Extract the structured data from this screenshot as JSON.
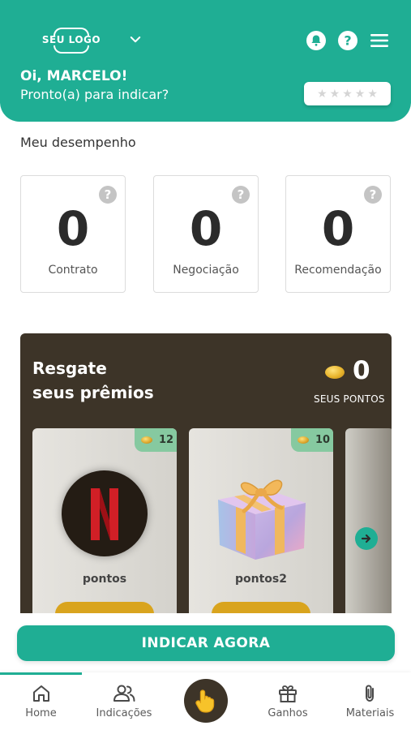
{
  "header": {
    "logo_text": "SEU LOGO",
    "greeting": "Oi, MARCELO!",
    "subtitle": "Pronto(a) para indicar?",
    "rating_stars": 5,
    "icons": [
      "bell-icon",
      "help-icon",
      "menu-icon",
      "chevron-down-icon"
    ]
  },
  "performance": {
    "title": "Meu desempenho",
    "stats": [
      {
        "value": "0",
        "label": "Contrato"
      },
      {
        "value": "0",
        "label": "Negociação"
      },
      {
        "value": "0",
        "label": "Recomendação"
      }
    ]
  },
  "rewards": {
    "title_line1": "Resgate",
    "title_line2": "seus prêmios",
    "points": "0",
    "points_label": "SEUS PONTOS",
    "prizes": [
      {
        "name": "pontos",
        "cost": "12"
      },
      {
        "name": "pontos2",
        "cost": "10"
      }
    ]
  },
  "cta": {
    "label": "INDICAR AGORA"
  },
  "nav": {
    "items": [
      {
        "label": "Home"
      },
      {
        "label": "Indicações"
      },
      {
        "label": "Ganhos"
      },
      {
        "label": "Materiais"
      }
    ]
  },
  "colors": {
    "primary": "#1fae94",
    "dark": "#3d3428",
    "gold": "#d9a41e"
  }
}
